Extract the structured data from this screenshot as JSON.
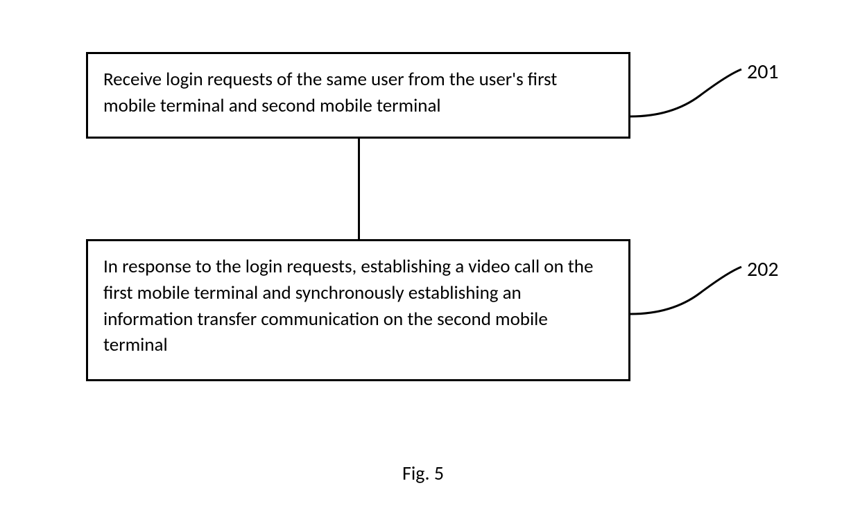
{
  "chart_data": {
    "type": "diagram",
    "title": "Fig. 5",
    "steps": [
      {
        "id": "201",
        "text": "Receive login requests of the same user from the user's first mobile terminal and second mobile terminal"
      },
      {
        "id": "202",
        "text": "In response to the login requests, establishing a video call on the first mobile terminal and synchronously establishing an information transfer communication on the second mobile terminal"
      }
    ]
  },
  "box1_text": "Receive login requests of the same user from the user's first mobile terminal and second mobile terminal",
  "box2_text": "In response to the login requests, establishing a video call on the first mobile terminal and synchronously establishing an information transfer communication on the second mobile terminal",
  "label1": "201",
  "label2": "202",
  "caption": "Fig. 5"
}
